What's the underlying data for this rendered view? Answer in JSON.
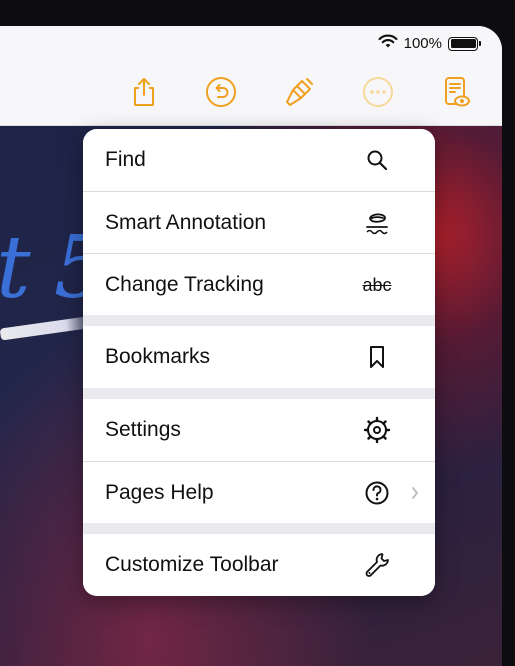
{
  "status": {
    "battery_text": "100%",
    "battery_level": 1.0
  },
  "toolbar": {
    "accent": "#f0a020",
    "buttons": [
      "share-icon",
      "undo-icon",
      "paintbrush-icon",
      "more-icon",
      "document-view-icon"
    ]
  },
  "document": {
    "title_fragment": "t 5"
  },
  "menu": {
    "groups": [
      [
        {
          "label": "Find",
          "icon": "magnifier-icon"
        },
        {
          "label": "Smart Annotation",
          "icon": "smart-annotation-icon"
        },
        {
          "label": "Change Tracking",
          "icon": "strikethrough-abc-icon",
          "icon_text": "abc"
        }
      ],
      [
        {
          "label": "Bookmarks",
          "icon": "bookmark-icon"
        }
      ],
      [
        {
          "label": "Settings",
          "icon": "gear-icon"
        },
        {
          "label": "Pages Help",
          "icon": "question-circle-icon",
          "chevron": "chevron-right-icon"
        }
      ],
      [
        {
          "label": "Customize Toolbar",
          "icon": "wrench-icon"
        }
      ]
    ]
  }
}
